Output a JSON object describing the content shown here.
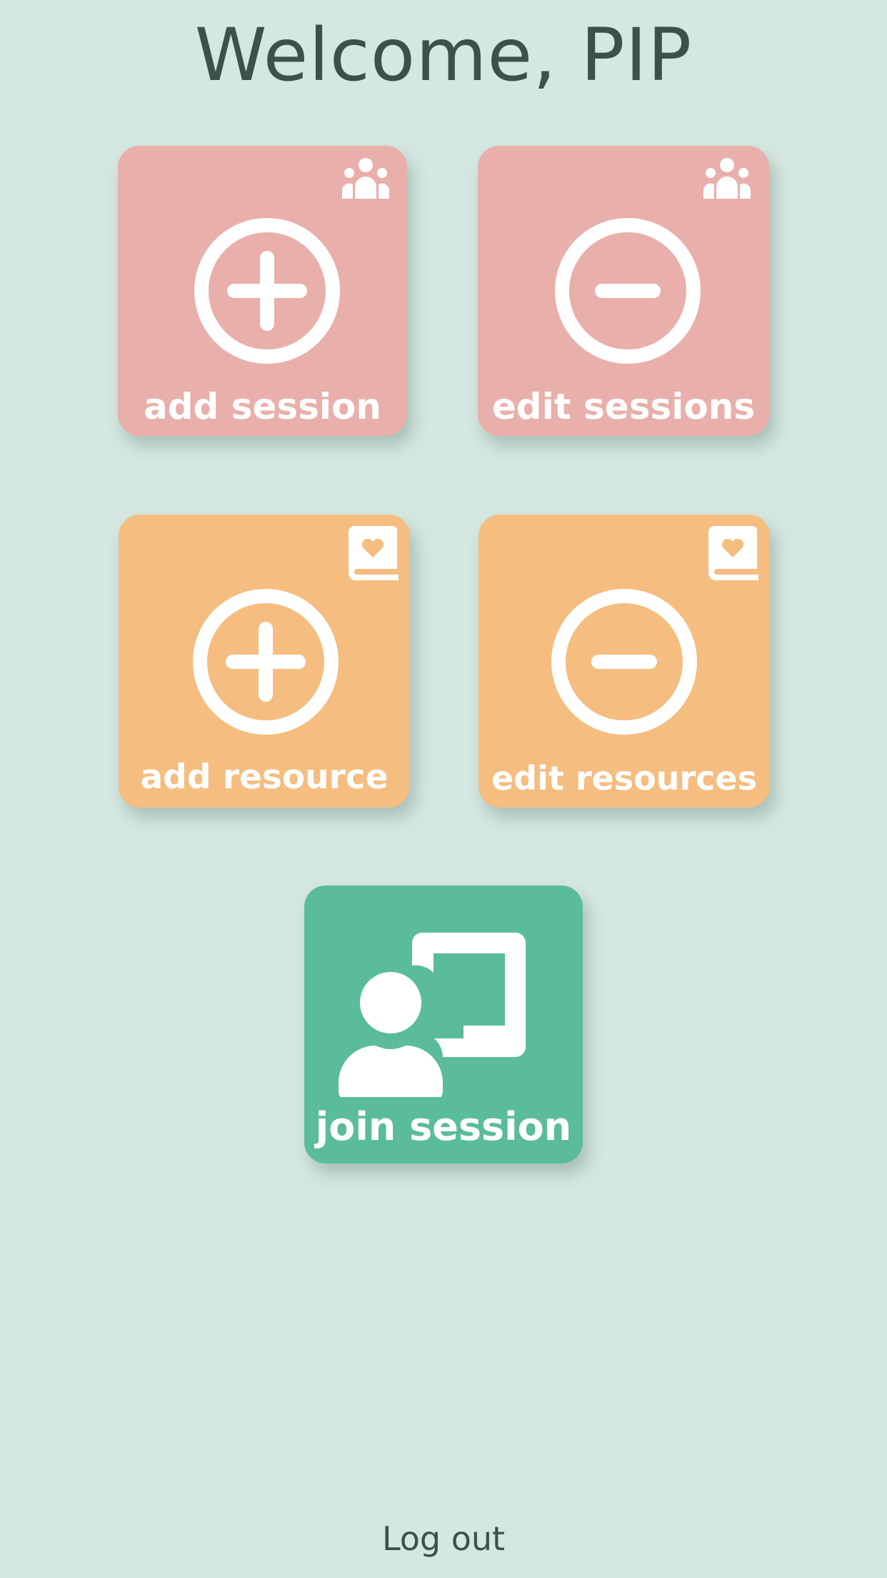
{
  "header": {
    "title": "Welcome, PIP"
  },
  "tiles": {
    "add_session": {
      "label": "add session",
      "icon": "plus-circle-icon",
      "badge_icon": "group-icon",
      "color": "#e9afaa"
    },
    "edit_sessions": {
      "label": "edit sessions",
      "icon": "minus-circle-icon",
      "badge_icon": "group-icon",
      "color": "#e9afaa"
    },
    "add_resource": {
      "label": "add resource",
      "icon": "plus-circle-icon",
      "badge_icon": "heart-book-icon",
      "color": "#f5bd7f"
    },
    "edit_resources": {
      "label": "edit resources",
      "icon": "minus-circle-icon",
      "badge_icon": "heart-book-icon",
      "color": "#f5bd7f"
    },
    "join_session": {
      "label": "join session",
      "icon": "teacher-board-icon",
      "color": "#5bbc9a"
    }
  },
  "footer": {
    "logout_label": "Log out"
  },
  "colors": {
    "background": "#d4e7e1",
    "text": "#3d5049"
  }
}
